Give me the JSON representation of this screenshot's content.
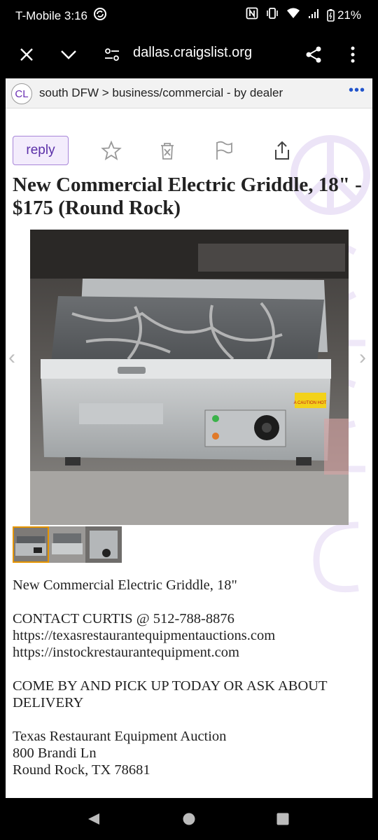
{
  "status_bar": {
    "carrier_time": "T-Mobile 3:16",
    "battery": "21%"
  },
  "browser": {
    "url": "dallas.craigslist.org"
  },
  "breadcrumb": {
    "logo": "CL",
    "path": "south DFW > business/commercial - by dealer",
    "more": "•••"
  },
  "actions": {
    "reply_label": "reply"
  },
  "post": {
    "title": "New Commercial Electric Griddle, 18\" - $175 (Round Rock)",
    "label_brand": "A CAUTION HOT",
    "body": {
      "line1": "New Commercial Electric Griddle, 18\"",
      "contact": "CONTACT CURTIS @ 512-788-8876",
      "url1": "https://texasrestaurantequipmentauctions.com",
      "url2": "https://instockrestaurantequipment.com",
      "pickup1": "COME BY AND PICK UP TODAY OR ASK ABOUT",
      "pickup2": "DELIVERY",
      "company": "Texas Restaurant Equipment Auction",
      "street": "800 Brandi Ln",
      "city": "Round Rock, TX 78681"
    }
  },
  "gallery": {
    "prev": "‹",
    "next": "›"
  },
  "colors": {
    "accent": "#6a2fb3",
    "reply_bg": "#f3ecfc",
    "thumb_selected": "#e59400"
  }
}
